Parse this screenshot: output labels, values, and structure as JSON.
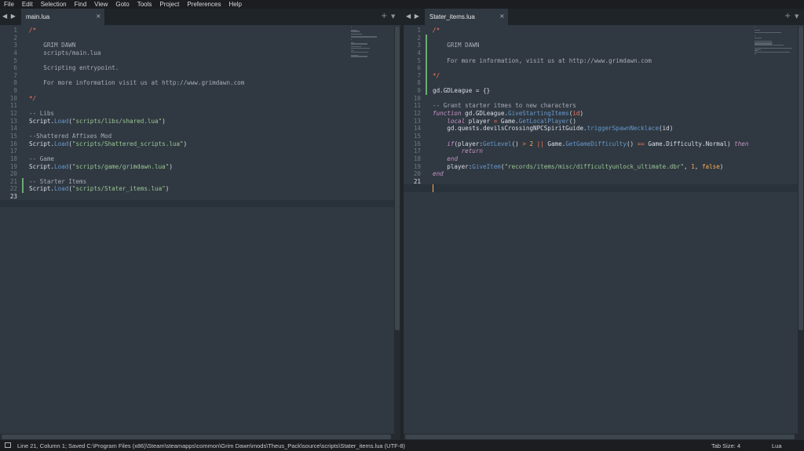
{
  "menu": [
    "File",
    "Edit",
    "Selection",
    "Find",
    "View",
    "Goto",
    "Tools",
    "Project",
    "Preferences",
    "Help"
  ],
  "left": {
    "nav": "◀ ▶",
    "tab": "main.lua",
    "close": "×",
    "plus": "+",
    "down": "▼",
    "line_numbers": [
      "1",
      "2",
      "3",
      "4",
      "5",
      "6",
      "7",
      "8",
      "9",
      "10",
      "11",
      "12",
      "13",
      "14",
      "15",
      "16",
      "17",
      "18",
      "19",
      "20",
      "21",
      "22",
      "23"
    ],
    "code": [
      [
        [
          "/*",
          "c-cslash"
        ]
      ],
      [],
      [
        [
          "    GRIM DAWN",
          "c-com"
        ]
      ],
      [
        [
          "    scripts/main.lua",
          "c-com"
        ]
      ],
      [],
      [
        [
          "    Scripting entrypoint.",
          "c-com"
        ]
      ],
      [],
      [
        [
          "    For more information visit us at http://www.grimdawn.com",
          "c-com"
        ]
      ],
      [],
      [
        [
          "*/",
          "c-cslash"
        ]
      ],
      [],
      [
        [
          "-- Libs",
          "c-com"
        ]
      ],
      [
        [
          "Script.",
          ""
        ],
        [
          "Load",
          "c-fn"
        ],
        [
          "(",
          ""
        ],
        [
          "\"scripts/libs/shared.lua\"",
          "c-str"
        ],
        [
          ")",
          ""
        ]
      ],
      [],
      [
        [
          "--Shattered Affixes Mod",
          "c-com"
        ]
      ],
      [
        [
          "Script.",
          ""
        ],
        [
          "Load",
          "c-fn"
        ],
        [
          "(",
          ""
        ],
        [
          "\"scripts/Shattered_scripts.lua\"",
          "c-str"
        ],
        [
          ")",
          ""
        ]
      ],
      [],
      [
        [
          "-- Game",
          "c-com"
        ]
      ],
      [
        [
          "Script.",
          ""
        ],
        [
          "Load",
          "c-fn"
        ],
        [
          "(",
          ""
        ],
        [
          "\"scripts/game/grimdawn.lua\"",
          "c-str"
        ],
        [
          ")",
          ""
        ]
      ],
      [],
      [
        [
          "-- Starter Items",
          "c-com"
        ]
      ],
      [
        [
          "Script.",
          ""
        ],
        [
          "Load",
          "c-fn"
        ],
        [
          "(",
          ""
        ],
        [
          "\"scripts/Stater_items.lua\"",
          "c-str"
        ],
        [
          ")",
          ""
        ]
      ],
      []
    ]
  },
  "right": {
    "nav": "◀ ▶",
    "tab": "Stater_items.lua",
    "close": "×",
    "plus": "+",
    "down": "▼",
    "line_numbers": [
      "1",
      "2",
      "3",
      "4",
      "5",
      "6",
      "7",
      "8",
      "9",
      "10",
      "11",
      "12",
      "13",
      "14",
      "15",
      "16",
      "17",
      "18",
      "19",
      "20",
      "21"
    ],
    "code": [
      [
        [
          "/*",
          "c-cslash"
        ]
      ],
      [],
      [
        [
          "    GRIM DAWN",
          "c-com"
        ]
      ],
      [],
      [
        [
          "    For more information, visit us at http://www.grimdawn.com",
          "c-com"
        ]
      ],
      [],
      [
        [
          "*/",
          "c-cslash"
        ]
      ],
      [],
      [
        [
          "gd.GDLeague = {}",
          ""
        ]
      ],
      [],
      [
        [
          "-- Grant starter itmes to new characters",
          "c-com"
        ]
      ],
      [
        [
          "function",
          "c-key"
        ],
        [
          " gd.GDLeague.",
          ""
        ],
        [
          "GiveStartingItems",
          "c-fn"
        ],
        [
          "(",
          ""
        ],
        [
          "id",
          "c-op"
        ],
        [
          ")",
          ""
        ]
      ],
      [
        [
          "    ",
          ""
        ],
        [
          "local",
          "c-key"
        ],
        [
          " player ",
          ""
        ],
        [
          "=",
          "c-op"
        ],
        [
          " Game.",
          ""
        ],
        [
          "GetLocalPlayer",
          "c-fn"
        ],
        [
          "()",
          ""
        ]
      ],
      [
        [
          "    gd.quests.devilsCrossingNPCSpiritGuide.",
          ""
        ],
        [
          "triggerSpawnNecklace",
          "c-fn"
        ],
        [
          "(id)",
          ""
        ]
      ],
      [],
      [
        [
          "    ",
          ""
        ],
        [
          "if",
          "c-key"
        ],
        [
          "(player:",
          ""
        ],
        [
          "GetLevel",
          "c-fn"
        ],
        [
          "() ",
          ""
        ],
        [
          ">",
          "c-op"
        ],
        [
          " ",
          ""
        ],
        [
          "2",
          "c-num"
        ],
        [
          " ",
          ""
        ],
        [
          "||",
          "c-op"
        ],
        [
          " Game.",
          ""
        ],
        [
          "GetGameDifficulty",
          "c-fn"
        ],
        [
          "() ",
          ""
        ],
        [
          "==",
          "c-op"
        ],
        [
          " Game.Difficulty.Normal) ",
          ""
        ],
        [
          "then",
          "c-key"
        ]
      ],
      [
        [
          "        ",
          ""
        ],
        [
          "return",
          "c-key"
        ]
      ],
      [
        [
          "    ",
          ""
        ],
        [
          "end",
          "c-key"
        ]
      ],
      [
        [
          "    player:",
          ""
        ],
        [
          "GiveItem",
          "c-fn"
        ],
        [
          "(",
          ""
        ],
        [
          "\"records/items/misc/difficultyunlock_ultimate.dbr\"",
          "c-str"
        ],
        [
          ", ",
          ""
        ],
        [
          "1",
          "c-num"
        ],
        [
          ", ",
          ""
        ],
        [
          "false",
          "c-kw"
        ],
        [
          ")",
          ""
        ]
      ],
      [
        [
          "end",
          "c-key"
        ]
      ],
      []
    ]
  },
  "status": {
    "text": "Line 21, Column 1; Saved C:\\Program Files (x86)\\Steam\\steamapps\\common\\Grim Dawn\\mods\\Theus_Pack\\source\\scripts\\Stater_items.lua (UTF-8)",
    "tab_size": "Tab Size: 4",
    "language": "Lua"
  }
}
